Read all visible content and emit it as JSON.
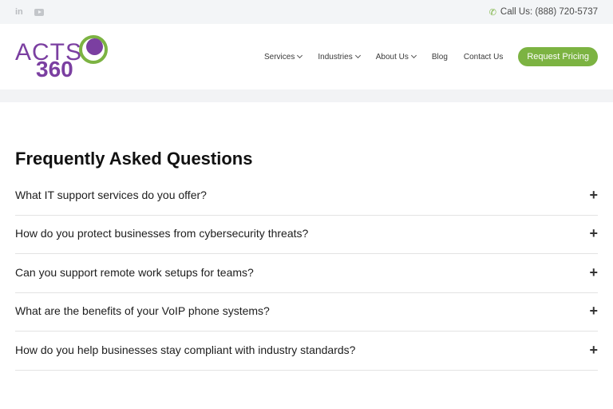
{
  "topbar": {
    "social": [
      {
        "icon": "linkedin-icon",
        "label": "in"
      },
      {
        "icon": "youtube-icon"
      }
    ],
    "call_label": "Call Us: (888) 720-5737"
  },
  "brand": {
    "logo_word": "ACTS",
    "logo_number": "360",
    "purple": "#7b3fa1",
    "green": "#7cb342"
  },
  "nav": {
    "items": [
      {
        "label": "Services",
        "dropdown": true
      },
      {
        "label": "Industries",
        "dropdown": true
      },
      {
        "label": "About Us",
        "dropdown": true
      },
      {
        "label": "Blog",
        "dropdown": false
      },
      {
        "label": "Contact Us",
        "dropdown": false
      }
    ],
    "cta_label": "Request Pricing"
  },
  "faq": {
    "title": "Frequently Asked Questions",
    "items": [
      {
        "question": "What IT support services do you offer?",
        "toggle": "+"
      },
      {
        "question": "How do you protect businesses from cybersecurity threats?",
        "toggle": "+"
      },
      {
        "question": "Can you support remote work setups for teams?",
        "toggle": "+"
      },
      {
        "question": "What are the benefits of your VoIP phone systems?",
        "toggle": "+"
      },
      {
        "question": "How do you help businesses stay compliant with industry standards?",
        "toggle": "+"
      }
    ]
  }
}
